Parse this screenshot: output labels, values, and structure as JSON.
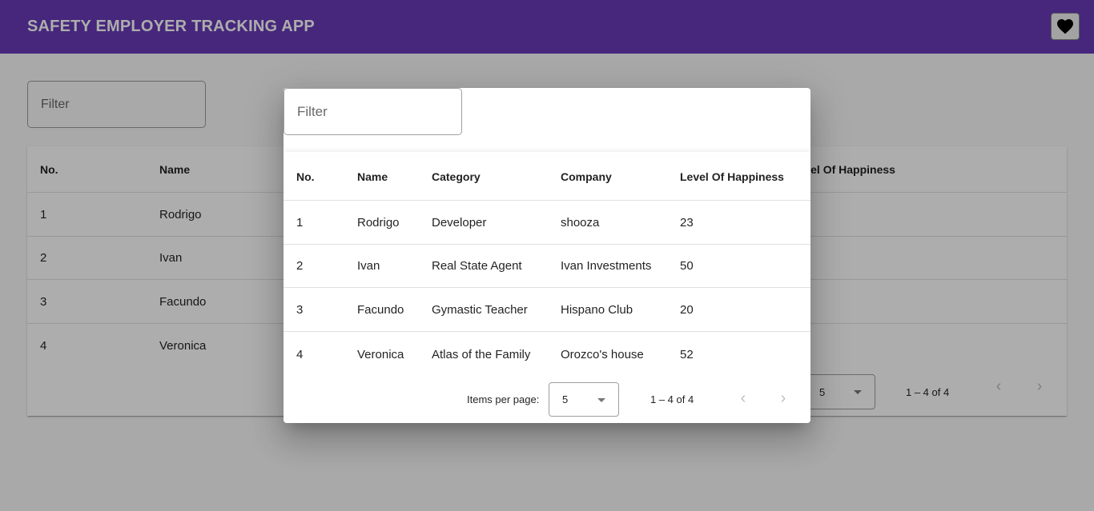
{
  "app": {
    "title": "SAFETY EMPLOYER TRACKING APP",
    "favorite_icon": "heart-icon"
  },
  "colors": {
    "toolbar": "#673ab7",
    "backdrop": "rgba(0,0,0,0.32)"
  },
  "background_page": {
    "filter_placeholder": "Filter",
    "columns": [
      "No.",
      "Name",
      "Level Of Happiness"
    ],
    "rows": [
      {
        "no": "1",
        "name": "Rodrigo"
      },
      {
        "no": "2",
        "name": "Ivan"
      },
      {
        "no": "3",
        "name": "Facundo"
      },
      {
        "no": "4",
        "name": "Veronica"
      }
    ],
    "paginator": {
      "page_size": "5",
      "range": "1 – 4 of 4"
    }
  },
  "dialog": {
    "filter_placeholder": "Filter",
    "columns": [
      "No.",
      "Name",
      "Category",
      "Company",
      "Level Of Happiness"
    ],
    "rows": [
      {
        "no": "1",
        "name": "Rodrigo",
        "category": "Developer",
        "company": "shooza",
        "happiness": "23"
      },
      {
        "no": "2",
        "name": "Ivan",
        "category": "Real State Agent",
        "company": "Ivan Investments",
        "happiness": "50"
      },
      {
        "no": "3",
        "name": "Facundo",
        "category": "Gymastic Teacher",
        "company": "Hispano Club",
        "happiness": "20"
      },
      {
        "no": "4",
        "name": "Veronica",
        "category": "Atlas of the Family",
        "company": "Orozco's house",
        "happiness": "52"
      }
    ],
    "paginator": {
      "items_per_page_label": "Items per page:",
      "page_size": "5",
      "range": "1 – 4 of 4",
      "prev_icon": "chevron-left-icon",
      "next_icon": "chevron-right-icon"
    }
  }
}
